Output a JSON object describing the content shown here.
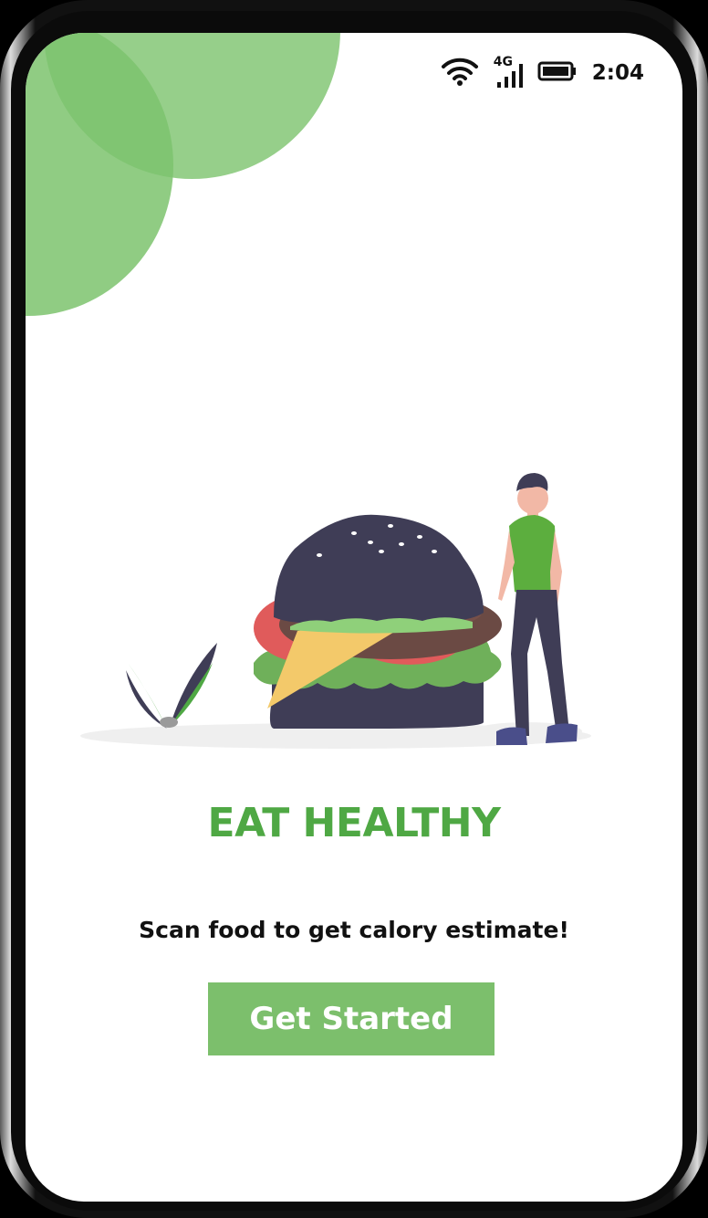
{
  "status_bar": {
    "time": "2:04",
    "network_label": "4G",
    "icons": [
      "wifi-icon",
      "signal-icon",
      "battery-icon"
    ]
  },
  "hero": {
    "title": "EAT HEALTHY",
    "subtitle": "Scan food to get calory estimate!",
    "illustration": "burger-illustration"
  },
  "cta": {
    "label": "Get Started"
  },
  "colors": {
    "accent": "#4fa844",
    "button": "#7cbf6c",
    "blob": "#7cc36d",
    "dark": "#3f3d56"
  }
}
